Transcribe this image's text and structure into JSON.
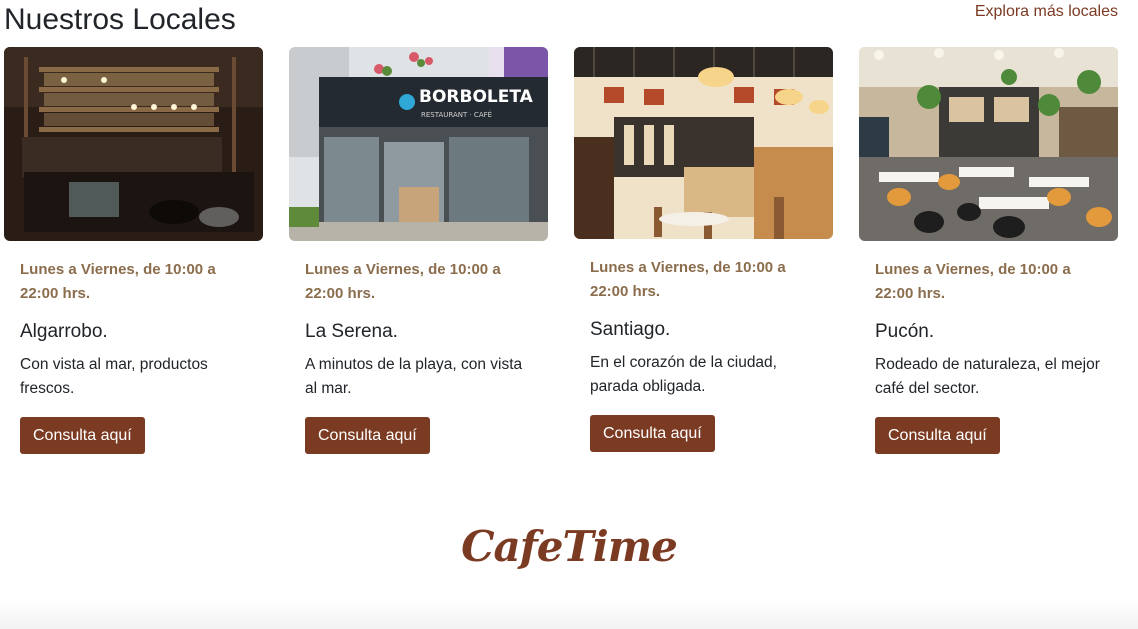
{
  "header": {
    "title": "Nuestros Locales",
    "explore_link": "Explora más locales"
  },
  "locations": [
    {
      "hours": "Lunes a Viernes, de 10:00 a 22:00 hrs.",
      "name": "Algarrobo.",
      "description": "Con vista al mar, productos frescos.",
      "button": "Consulta aquí"
    },
    {
      "hours": "Lunes a Viernes, de 10:00 a 22:00 hrs.",
      "name": "La Serena.",
      "description": "A minutos de la playa, con vista al mar.",
      "button": "Consulta aquí",
      "photo_sign": "BORBOLETA",
      "photo_subsign": "RESTAURANT · CAFÉ"
    },
    {
      "hours": "Lunes a Viernes, de 10:00 a 22:00 hrs.",
      "name": "Santiago.",
      "description": "En el corazón de la ciudad, parada obligada.",
      "button": "Consulta aquí"
    },
    {
      "hours": "Lunes a Viernes, de 10:00 a 22:00 hrs.",
      "name": "Pucón.",
      "description": "Rodeado de naturaleza, el mejor café del sector.",
      "button": "Consulta aquí"
    }
  ],
  "footer": {
    "brand": "CafeTime"
  },
  "colors": {
    "accent": "#7b3a22",
    "hours_text": "#8b6d4d",
    "body_text": "#212529"
  }
}
